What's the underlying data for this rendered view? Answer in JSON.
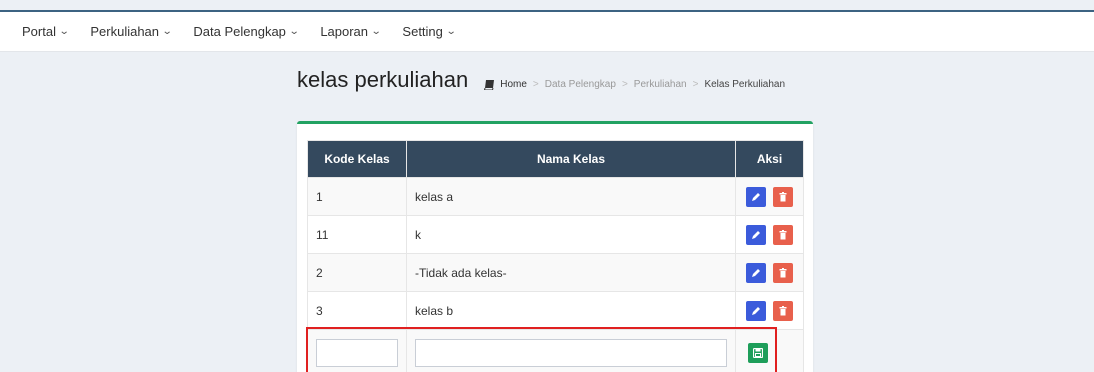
{
  "nav": {
    "items": [
      {
        "label": "Portal"
      },
      {
        "label": "Perkuliahan"
      },
      {
        "label": "Data Pelengkap"
      },
      {
        "label": "Laporan"
      },
      {
        "label": "Setting"
      }
    ]
  },
  "header": {
    "title": "kelas perkuliahan",
    "breadcrumb": [
      "Home",
      "Data Pelengkap",
      "Perkuliahan",
      "Kelas Perkuliahan"
    ]
  },
  "table": {
    "columns": [
      "Kode Kelas",
      "Nama Kelas",
      "Aksi"
    ],
    "rows": [
      {
        "kode": "1",
        "nama": "kelas a"
      },
      {
        "kode": "11",
        "nama": "k"
      },
      {
        "kode": "2",
        "nama": "-Tidak ada kelas-"
      },
      {
        "kode": "3",
        "nama": "kelas b"
      }
    ],
    "new_row": {
      "kode_value": "",
      "nama_value": ""
    }
  },
  "colors": {
    "header_bg": "#34495e",
    "edit": "#3b5bdb",
    "delete": "#e8604c",
    "save": "#1e9e5a",
    "box_accent": "#22a262",
    "highlight": "#e02020"
  },
  "icons": {
    "edit": "pencil-icon",
    "delete": "trash-icon",
    "save": "save-icon",
    "breadcrumb": "book-icon",
    "dropdown": "chevron-down-icon"
  }
}
